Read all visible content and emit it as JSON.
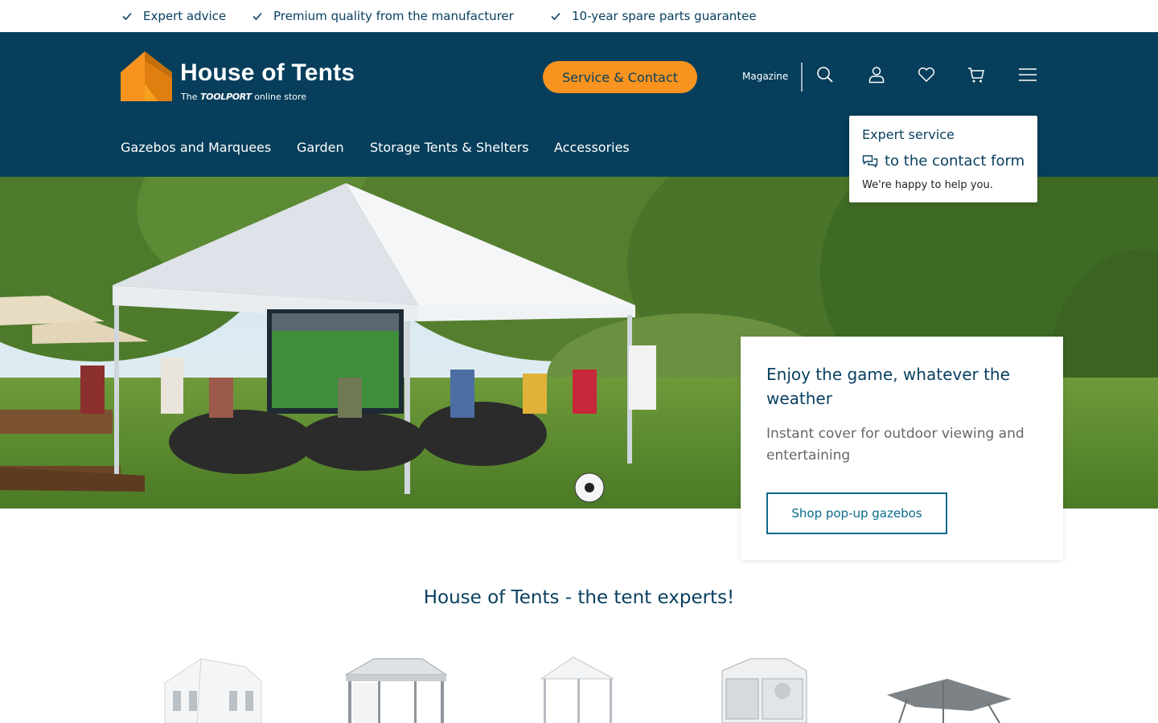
{
  "usp": [
    {
      "text": "Expert advice",
      "icon": "check-icon"
    },
    {
      "text": "Premium quality from the manufacturer",
      "icon": "check-icon"
    },
    {
      "text": "10-year spare parts guarantee",
      "icon": "check-icon"
    }
  ],
  "header": {
    "logo_title": "House of Tents",
    "logo_sub_prefix": "The",
    "logo_sub_brand": "TOOLPORT",
    "logo_sub_suffix": "online store",
    "service_button": "Service & Contact",
    "magazine": "Magazine",
    "icons": [
      "search-icon",
      "user-icon",
      "heart-icon",
      "cart-icon",
      "menu-icon"
    ],
    "colors": {
      "background": "#063e5b",
      "accent": "#f7931e"
    }
  },
  "nav": [
    "Gazebos and Marquees",
    "Garden",
    "Storage Tents & Shelters",
    "Accessories"
  ],
  "popup": {
    "title": "Expert service",
    "link": "to the contact form",
    "link_icon": "chat-icon",
    "note": "We're happy to help you."
  },
  "hero": {
    "heading": "Enjoy the game, whatever the weather",
    "text": "Instant cover for outdoor viewing and entertaining",
    "cta": "Shop pop-up gazebos"
  },
  "section_title": "House of Tents - the tent experts!",
  "categories": [
    "party-tent-image",
    "pavilion-gazebo-image",
    "pop-up-gazebo-image",
    "storage-tent-image",
    "sail-shade-image"
  ]
}
